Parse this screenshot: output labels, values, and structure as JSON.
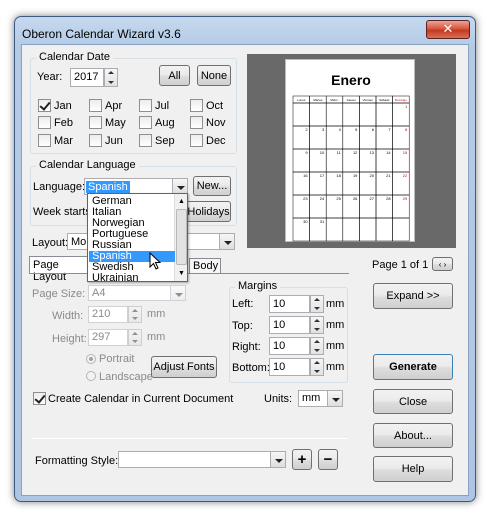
{
  "window": {
    "title": "Oberon Calendar Wizard v3.6",
    "close_glyph": "✕"
  },
  "calendar_date": {
    "legend": "Calendar Date",
    "year_label": "Year:",
    "year_value": "2017",
    "all_label": "All",
    "none_label": "None",
    "months": [
      {
        "label": "Jan",
        "checked": true
      },
      {
        "label": "Apr",
        "checked": false
      },
      {
        "label": "Jul",
        "checked": false
      },
      {
        "label": "Oct",
        "checked": false
      },
      {
        "label": "Feb",
        "checked": false
      },
      {
        "label": "May",
        "checked": false
      },
      {
        "label": "Aug",
        "checked": false
      },
      {
        "label": "Nov",
        "checked": false
      },
      {
        "label": "Mar",
        "checked": false
      },
      {
        "label": "Jun",
        "checked": false
      },
      {
        "label": "Sep",
        "checked": false
      },
      {
        "label": "Dec",
        "checked": false
      }
    ]
  },
  "calendar_language": {
    "legend": "Calendar Language",
    "language_label": "Language:",
    "language_value": "Spanish",
    "new_label": "New...",
    "week_starts_label": "Week starts",
    "holidays_label": "Holidays",
    "options": [
      "German",
      "Italian",
      "Norwegian",
      "Portuguese",
      "Russian",
      "Spanish",
      "Swedish",
      "Ukrainian"
    ],
    "selected_index": 5
  },
  "layout": {
    "label": "Layout:",
    "value": "Mo"
  },
  "tabs": {
    "page_layout": "Page Layout",
    "body": "Body"
  },
  "page_layout": {
    "page_size_label": "Page Size:",
    "page_size_value": "A4",
    "width_label": "Width:",
    "width_value": "210",
    "height_label": "Height:",
    "height_value": "297",
    "unit_mm": "mm",
    "portrait_label": "Portrait",
    "landscape_label": "Landscape",
    "adjust_fonts_label": "Adjust Fonts"
  },
  "margins": {
    "legend": "Margins",
    "left_label": "Left:",
    "left_value": "10",
    "top_label": "Top:",
    "top_value": "10",
    "right_label": "Right:",
    "right_value": "10",
    "bottom_label": "Bottom:",
    "bottom_value": "10",
    "unit": "mm"
  },
  "create_in_current_label": "Create Calendar in Current Document",
  "create_in_current_checked": true,
  "units_label": "Units:",
  "units_value": "mm",
  "formatting_style_label": "Formatting Style:",
  "formatting_style_value": "",
  "plus_label": "+",
  "minus_label": "−",
  "preview": {
    "page_indicator": "Page 1 of 1",
    "month_title": "Enero",
    "weekdays": [
      "Lunes",
      "Martes",
      "Miérc.",
      "Jueves",
      "Viernes",
      "Sábado",
      "Domingo"
    ],
    "weeks": [
      [
        "",
        "",
        "",
        "",
        "",
        "",
        "1"
      ],
      [
        "2",
        "3",
        "4",
        "5",
        "6",
        "7",
        "8"
      ],
      [
        "9",
        "10",
        "11",
        "12",
        "13",
        "14",
        "15"
      ],
      [
        "16",
        "17",
        "18",
        "19",
        "20",
        "21",
        "22"
      ],
      [
        "23",
        "24",
        "25",
        "26",
        "27",
        "28",
        "29"
      ],
      [
        "30",
        "31",
        "",
        "",
        "",
        "",
        ""
      ]
    ]
  },
  "buttons": {
    "expand": "Expand >>",
    "generate": "Generate",
    "close": "Close",
    "about": "About...",
    "help": "Help"
  }
}
